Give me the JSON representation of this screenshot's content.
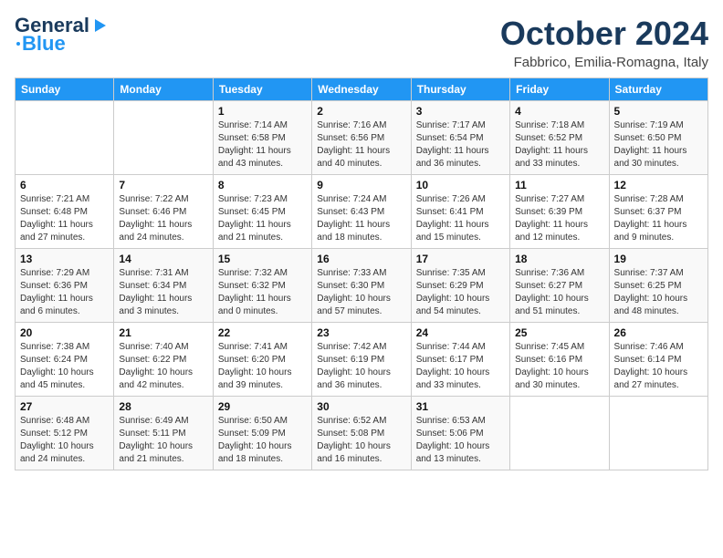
{
  "header": {
    "logo_line1": "General",
    "logo_line2": "Blue",
    "title": "October 2024",
    "subtitle": "Fabbrico, Emilia-Romagna, Italy"
  },
  "days_of_week": [
    "Sunday",
    "Monday",
    "Tuesday",
    "Wednesday",
    "Thursday",
    "Friday",
    "Saturday"
  ],
  "weeks": [
    [
      {
        "day": "",
        "info": ""
      },
      {
        "day": "",
        "info": ""
      },
      {
        "day": "1",
        "info": "Sunrise: 7:14 AM\nSunset: 6:58 PM\nDaylight: 11 hours and 43 minutes."
      },
      {
        "day": "2",
        "info": "Sunrise: 7:16 AM\nSunset: 6:56 PM\nDaylight: 11 hours and 40 minutes."
      },
      {
        "day": "3",
        "info": "Sunrise: 7:17 AM\nSunset: 6:54 PM\nDaylight: 11 hours and 36 minutes."
      },
      {
        "day": "4",
        "info": "Sunrise: 7:18 AM\nSunset: 6:52 PM\nDaylight: 11 hours and 33 minutes."
      },
      {
        "day": "5",
        "info": "Sunrise: 7:19 AM\nSunset: 6:50 PM\nDaylight: 11 hours and 30 minutes."
      }
    ],
    [
      {
        "day": "6",
        "info": "Sunrise: 7:21 AM\nSunset: 6:48 PM\nDaylight: 11 hours and 27 minutes."
      },
      {
        "day": "7",
        "info": "Sunrise: 7:22 AM\nSunset: 6:46 PM\nDaylight: 11 hours and 24 minutes."
      },
      {
        "day": "8",
        "info": "Sunrise: 7:23 AM\nSunset: 6:45 PM\nDaylight: 11 hours and 21 minutes."
      },
      {
        "day": "9",
        "info": "Sunrise: 7:24 AM\nSunset: 6:43 PM\nDaylight: 11 hours and 18 minutes."
      },
      {
        "day": "10",
        "info": "Sunrise: 7:26 AM\nSunset: 6:41 PM\nDaylight: 11 hours and 15 minutes."
      },
      {
        "day": "11",
        "info": "Sunrise: 7:27 AM\nSunset: 6:39 PM\nDaylight: 11 hours and 12 minutes."
      },
      {
        "day": "12",
        "info": "Sunrise: 7:28 AM\nSunset: 6:37 PM\nDaylight: 11 hours and 9 minutes."
      }
    ],
    [
      {
        "day": "13",
        "info": "Sunrise: 7:29 AM\nSunset: 6:36 PM\nDaylight: 11 hours and 6 minutes."
      },
      {
        "day": "14",
        "info": "Sunrise: 7:31 AM\nSunset: 6:34 PM\nDaylight: 11 hours and 3 minutes."
      },
      {
        "day": "15",
        "info": "Sunrise: 7:32 AM\nSunset: 6:32 PM\nDaylight: 11 hours and 0 minutes."
      },
      {
        "day": "16",
        "info": "Sunrise: 7:33 AM\nSunset: 6:30 PM\nDaylight: 10 hours and 57 minutes."
      },
      {
        "day": "17",
        "info": "Sunrise: 7:35 AM\nSunset: 6:29 PM\nDaylight: 10 hours and 54 minutes."
      },
      {
        "day": "18",
        "info": "Sunrise: 7:36 AM\nSunset: 6:27 PM\nDaylight: 10 hours and 51 minutes."
      },
      {
        "day": "19",
        "info": "Sunrise: 7:37 AM\nSunset: 6:25 PM\nDaylight: 10 hours and 48 minutes."
      }
    ],
    [
      {
        "day": "20",
        "info": "Sunrise: 7:38 AM\nSunset: 6:24 PM\nDaylight: 10 hours and 45 minutes."
      },
      {
        "day": "21",
        "info": "Sunrise: 7:40 AM\nSunset: 6:22 PM\nDaylight: 10 hours and 42 minutes."
      },
      {
        "day": "22",
        "info": "Sunrise: 7:41 AM\nSunset: 6:20 PM\nDaylight: 10 hours and 39 minutes."
      },
      {
        "day": "23",
        "info": "Sunrise: 7:42 AM\nSunset: 6:19 PM\nDaylight: 10 hours and 36 minutes."
      },
      {
        "day": "24",
        "info": "Sunrise: 7:44 AM\nSunset: 6:17 PM\nDaylight: 10 hours and 33 minutes."
      },
      {
        "day": "25",
        "info": "Sunrise: 7:45 AM\nSunset: 6:16 PM\nDaylight: 10 hours and 30 minutes."
      },
      {
        "day": "26",
        "info": "Sunrise: 7:46 AM\nSunset: 6:14 PM\nDaylight: 10 hours and 27 minutes."
      }
    ],
    [
      {
        "day": "27",
        "info": "Sunrise: 6:48 AM\nSunset: 5:12 PM\nDaylight: 10 hours and 24 minutes."
      },
      {
        "day": "28",
        "info": "Sunrise: 6:49 AM\nSunset: 5:11 PM\nDaylight: 10 hours and 21 minutes."
      },
      {
        "day": "29",
        "info": "Sunrise: 6:50 AM\nSunset: 5:09 PM\nDaylight: 10 hours and 18 minutes."
      },
      {
        "day": "30",
        "info": "Sunrise: 6:52 AM\nSunset: 5:08 PM\nDaylight: 10 hours and 16 minutes."
      },
      {
        "day": "31",
        "info": "Sunrise: 6:53 AM\nSunset: 5:06 PM\nDaylight: 10 hours and 13 minutes."
      },
      {
        "day": "",
        "info": ""
      },
      {
        "day": "",
        "info": ""
      }
    ]
  ]
}
